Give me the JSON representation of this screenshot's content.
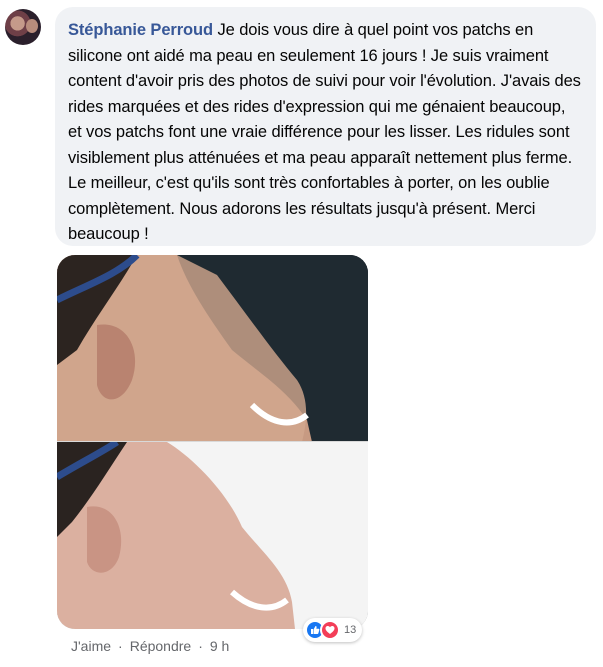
{
  "comment": {
    "author": "Stéphanie Perroud",
    "text": "Je dois vous dire à quel point vos patchs en silicone ont aidé ma peau en seulement 16 jours ! Je suis vraiment content d'avoir pris des photos de suivi pour voir l'évolution. J'avais des rides marquées et des rides d'expression qui me génaient beaucoup, et vos patchs font une vraie différence pour les lisser. Les ridules sont visiblement plus atténuées et ma peau apparaît nettement plus ferme. Le meilleur, c'est qu'ils sont très confortables à porter, on les oublie complètement. Nous adorons les résultats jusqu'à présent. Merci beaucoup !"
  },
  "reactions": {
    "icons": [
      "like-icon",
      "love-icon"
    ],
    "count": "13",
    "colors": {
      "like": "#1877f2",
      "love": "#f33e58"
    }
  },
  "actions": {
    "like_label": "J'aime",
    "separator": "·",
    "reply_label": "Répondre",
    "timestamp": "9 h"
  },
  "theme": {
    "bubble_bg": "#f0f2f5",
    "author_color": "#385898",
    "meta_color": "#65676b"
  }
}
